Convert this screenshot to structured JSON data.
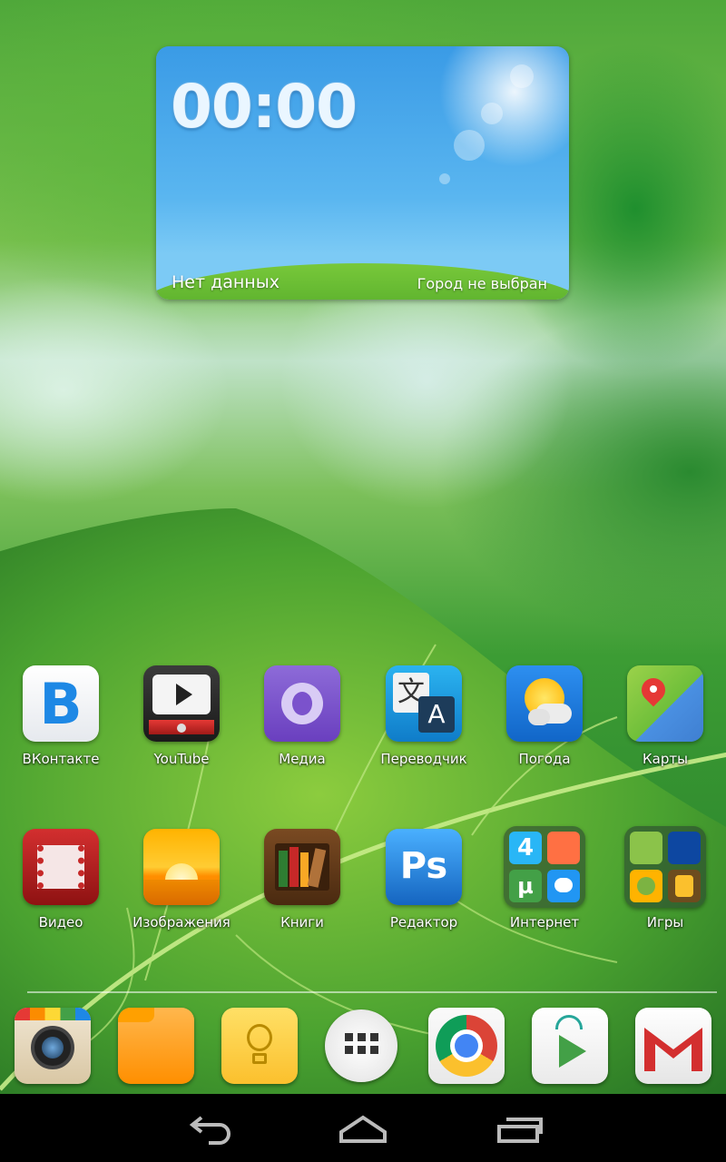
{
  "weather_widget": {
    "time": "00:00",
    "status": "Нет данных",
    "city": "Город не выбран"
  },
  "apps_row1": [
    {
      "label": "ВКонтакте",
      "icon": "vk-icon"
    },
    {
      "label": "YouTube",
      "icon": "youtube-icon"
    },
    {
      "label": "Медиа",
      "icon": "media-icon"
    },
    {
      "label": "Переводчик",
      "icon": "translate-icon"
    },
    {
      "label": "Погода",
      "icon": "weather-icon"
    },
    {
      "label": "Карты",
      "icon": "maps-icon"
    }
  ],
  "apps_row2": [
    {
      "label": "Видео",
      "icon": "video-icon"
    },
    {
      "label": "Изображения",
      "icon": "gallery-icon"
    },
    {
      "label": "Книги",
      "icon": "books-icon"
    },
    {
      "label": "Редактор",
      "icon": "photoshop-icon"
    },
    {
      "label": "Интернет",
      "icon": "internet-folder-icon"
    },
    {
      "label": "Игры",
      "icon": "games-folder-icon"
    }
  ],
  "dock": [
    {
      "icon": "camera-icon"
    },
    {
      "icon": "files-icon"
    },
    {
      "icon": "notes-icon"
    },
    {
      "icon": "app-drawer-icon"
    },
    {
      "icon": "chrome-icon"
    },
    {
      "icon": "play-store-icon"
    },
    {
      "icon": "gmail-icon"
    }
  ],
  "navbar": {
    "buttons": [
      "back-icon",
      "home-icon",
      "recents-icon"
    ]
  },
  "vk_letter": "B",
  "ps_text": "Ps",
  "internet_folder_num": "4",
  "colors": {
    "vk_blue": "#1e88e5",
    "widget_sky": "#3a9be6",
    "navbar": "#000000"
  }
}
